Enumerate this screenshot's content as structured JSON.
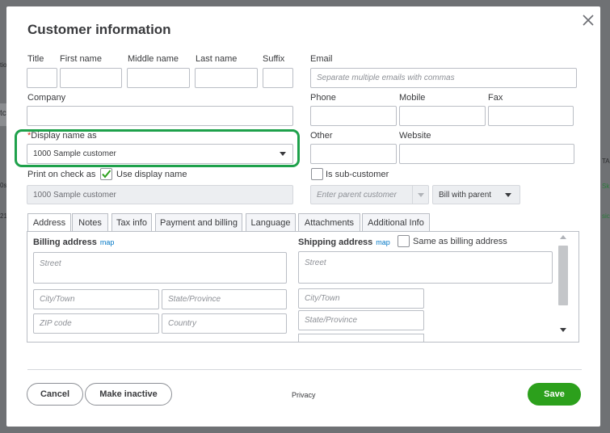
{
  "dialog": {
    "title": "Customer information",
    "save_label": "Save",
    "cancel_label": "Cancel",
    "make_inactive_label": "Make inactive",
    "privacy_label": "Privacy"
  },
  "name_fields": {
    "title_label": "Title",
    "first_name_label": "First name",
    "middle_name_label": "Middle name",
    "last_name_label": "Last name",
    "suffix_label": "Suffix",
    "company_label": "Company",
    "display_name_label": "Display name as",
    "required_marker": "*",
    "display_name_value": "1000 Sample customer",
    "print_on_check_label": "Print on check as",
    "use_display_name_label": "Use display name",
    "print_on_check_value": "1000 Sample customer"
  },
  "contact_fields": {
    "email_label": "Email",
    "email_placeholder": "Separate multiple emails with commas",
    "phone_label": "Phone",
    "mobile_label": "Mobile",
    "fax_label": "Fax",
    "other_label": "Other",
    "website_label": "Website",
    "sub_customer_label": "Is sub-customer",
    "parent_customer_placeholder": "Enter parent customer",
    "bill_with_parent_label": "Bill with parent"
  },
  "tabs": [
    {
      "label": "Address"
    },
    {
      "label": "Notes"
    },
    {
      "label": "Tax info"
    },
    {
      "label": "Payment and billing"
    },
    {
      "label": "Language"
    },
    {
      "label": "Attachments"
    },
    {
      "label": "Additional Info"
    }
  ],
  "address": {
    "billing_label": "Billing address",
    "shipping_label": "Shipping address",
    "map_link": "map",
    "same_as_billing_label": "Same as billing address",
    "street_placeholder": "Street",
    "city_placeholder": "City/Town",
    "state_placeholder": "State/Province",
    "zip_placeholder": "ZIP code",
    "country_placeholder": "Country"
  },
  "background": {
    "left_text_1": "tio",
    "left_text_2": "tc",
    "right_text_1": "TA",
    "right_text_2": "Sk",
    "right_text_3": "sic",
    "left_text_3": "0s",
    "left_text_4": "21"
  },
  "colors": {
    "accent_green": "#2ca01c",
    "highlight_green": "#1ea14b",
    "link_blue": "#0077c5"
  }
}
